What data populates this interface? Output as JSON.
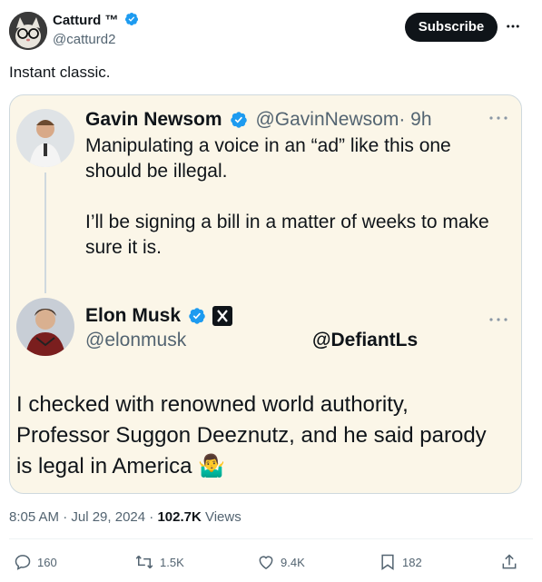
{
  "author": {
    "name": "Catturd ™",
    "handle": "@catturd2",
    "verified": true
  },
  "header": {
    "subscribe_label": "Subscribe",
    "more_icon": "more-horizontal-icon"
  },
  "tweet_text": "Instant classic.",
  "embedded": {
    "newsom": {
      "name": "Gavin Newsom",
      "handle": "@GavinNewsom",
      "time": "· 9h",
      "text1": "Manipulating a voice in an “ad” like this one",
      "text2": "should be illegal.",
      "text3": "I’ll be signing a bill in a matter of weeks to make",
      "text4": "sure it is."
    },
    "musk": {
      "name": "Elon Musk",
      "handle": "@elonmusk",
      "watermark": "@DefiantLs",
      "text1": "I checked with renowned world authority,",
      "text2": "Professor Suggon Deeznutz, and he said parody",
      "text3": "is legal in America",
      "emoji": "🤷‍♂️"
    }
  },
  "meta": {
    "time": "8:05 AM · Jul 29, 2024 · ",
    "views_count": "102.7K",
    "views_label": " Views"
  },
  "actions": {
    "replies": "160",
    "reposts": "1.5K",
    "likes": "9.4K",
    "bookmarks": "182"
  },
  "colors": {
    "verified_blue": "#1d9bf0",
    "card_bg": "#fbf6e8",
    "muted": "#536471"
  }
}
